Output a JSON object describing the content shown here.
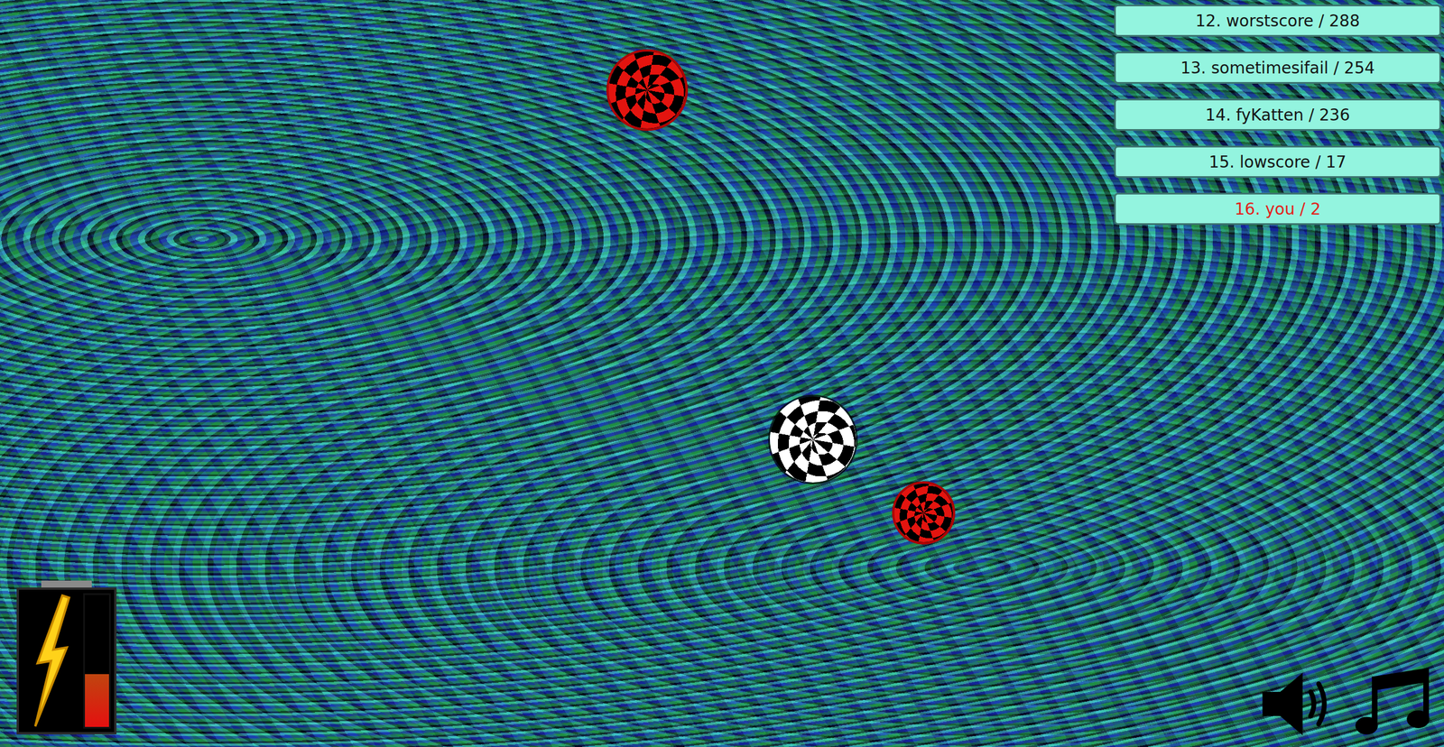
{
  "leaderboard": [
    {
      "label": "12. worstscore / 288",
      "selected": false
    },
    {
      "label": "13. sometimesifail / 254",
      "selected": false
    },
    {
      "label": "14. fyKatten / 236",
      "selected": false
    },
    {
      "label": "15. lowscore / 17",
      "selected": false
    },
    {
      "label": "16. you / 2",
      "selected": true
    }
  ],
  "energy": {
    "level": 0.4
  },
  "balls": [
    {
      "kind": "enemy",
      "color": "#e3140f"
    },
    {
      "kind": "player",
      "color": "#ffffff"
    },
    {
      "kind": "enemy",
      "color": "#e3140f"
    }
  ],
  "sound": {
    "on": true
  },
  "music": {
    "on": true
  }
}
